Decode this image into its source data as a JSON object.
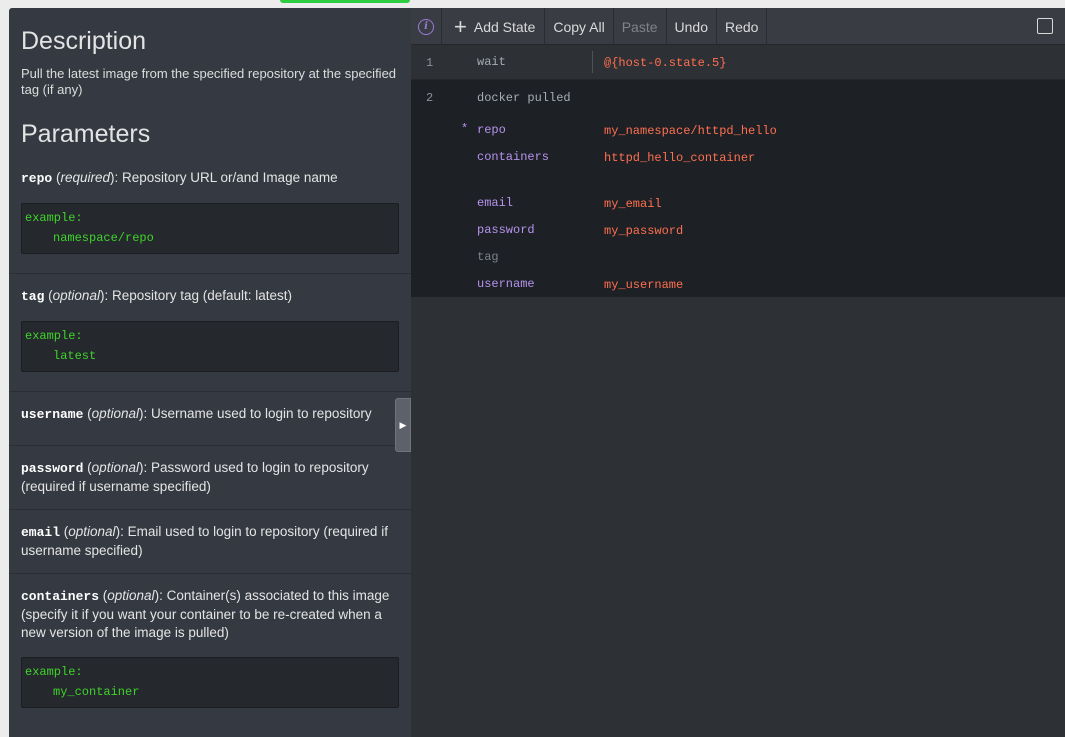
{
  "help": {
    "description_title": "Description",
    "description_text": "Pull the latest image from the specified repository at the specified tag (if any)",
    "parameters_title": "Parameters",
    "params": [
      {
        "name": "repo",
        "qualifier": "required",
        "text": ": Repository URL or/and Image name",
        "example_label": "example:",
        "example_value": "namespace/repo"
      },
      {
        "name": "tag",
        "qualifier": "optional",
        "text": ": Repository tag (default: latest)",
        "example_label": "example:",
        "example_value": "latest"
      },
      {
        "name": "username",
        "qualifier": "optional",
        "text": ": Username used to login to repository"
      },
      {
        "name": "password",
        "qualifier": "optional",
        "text": ": Password used to login to repository (required if username specified)"
      },
      {
        "name": "email",
        "qualifier": "optional",
        "text": ": Email used to login to repository (required if username specified)"
      },
      {
        "name": "containers",
        "qualifier": "optional",
        "text": ": Container(s) associated to this image (specify it if you want your container to be re-created when a new version of the image is pulled)",
        "example_label": "example:",
        "example_value": "my_container"
      }
    ]
  },
  "toolbar": {
    "add_state": "Add State",
    "copy_all": "Copy All",
    "paste": "Paste",
    "undo": "Undo",
    "redo": "Redo"
  },
  "states": {
    "row1": {
      "line": "1",
      "key": "wait",
      "value": "@{host-0.state.5}"
    },
    "row2": {
      "line": "2",
      "header": "docker pulled",
      "fields": [
        {
          "star": "*",
          "key": "repo",
          "value": "my_namespace/httpd_hello"
        },
        {
          "key": "containers",
          "value": "httpd_hello_container"
        },
        {
          "key": "email",
          "value": "my_email"
        },
        {
          "key": "password",
          "value": "my_password"
        },
        {
          "key": "tag",
          "value": ""
        },
        {
          "key": "username",
          "value": "my_username"
        }
      ]
    }
  },
  "colors": {
    "accent_value": "#ff6f4e",
    "key_purple": "#b793ee",
    "example_green": "#3ed42b"
  }
}
